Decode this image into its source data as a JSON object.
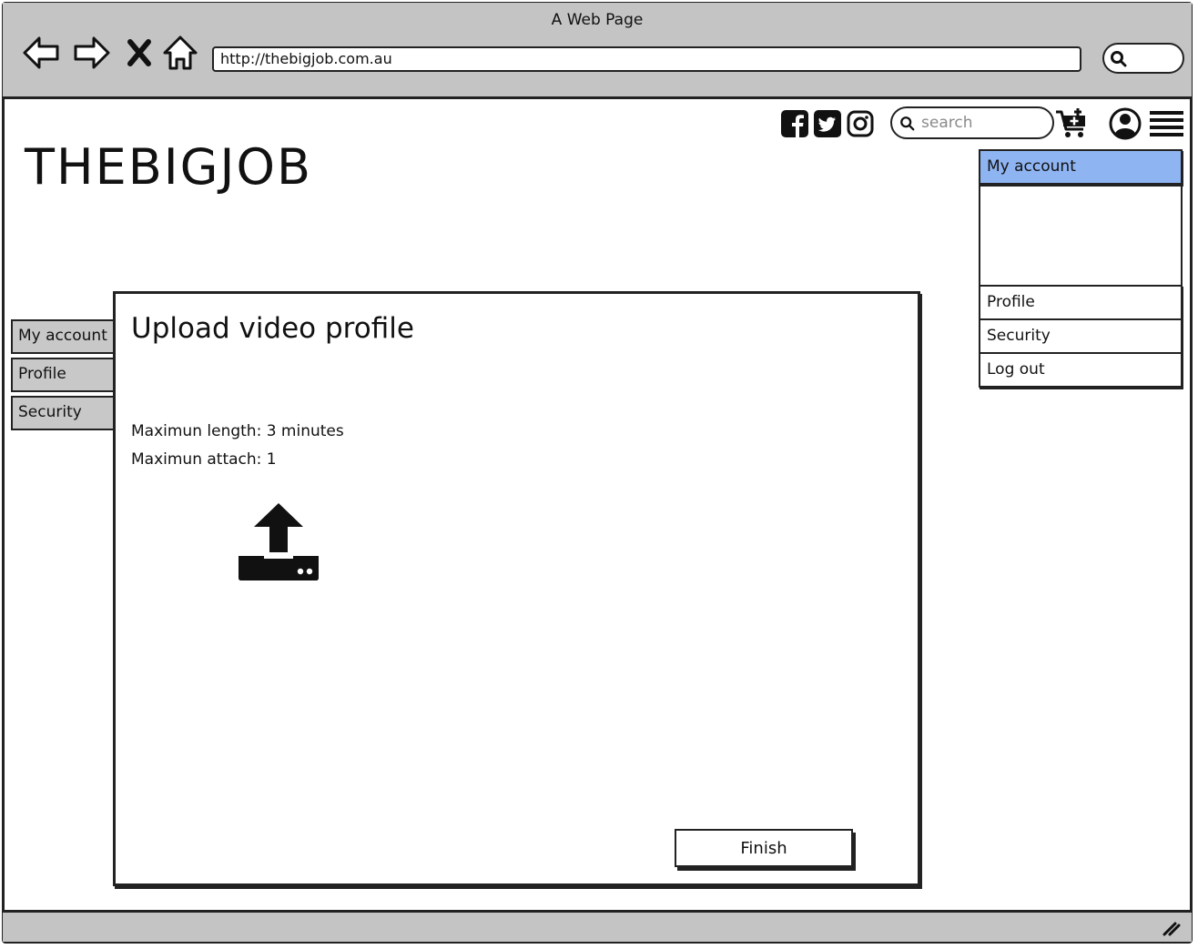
{
  "window": {
    "title": "A Web Page",
    "url": "http://thebigjob.com.au"
  },
  "site": {
    "logo": "THEBIGJOB",
    "search_placeholder": "search"
  },
  "icons": {
    "back": "arrow-left-icon",
    "forward": "arrow-right-icon",
    "stop": "close-icon",
    "home": "home-icon",
    "facebook": "facebook-icon",
    "twitter": "twitter-icon",
    "instagram": "instagram-icon",
    "cart": "cart-add-icon",
    "user": "user-icon",
    "menu": "hamburger-menu-icon",
    "upload": "upload-icon"
  },
  "account_menu": {
    "header": "My account",
    "items": [
      {
        "label": "Profile"
      },
      {
        "label": "Security"
      },
      {
        "label": "Log out"
      }
    ]
  },
  "side_tabs": [
    {
      "label": "My account"
    },
    {
      "label": "Profile"
    },
    {
      "label": "Security"
    }
  ],
  "modal": {
    "title": "Upload video profile",
    "max_length": "Maximun length: 3 minutes",
    "max_attach": "Maximun attach: 1",
    "finish_label": "Finish"
  },
  "colors": {
    "chrome": "#c4c4c4",
    "selected": "#8fb4f2",
    "tab": "#c8c8c8"
  }
}
